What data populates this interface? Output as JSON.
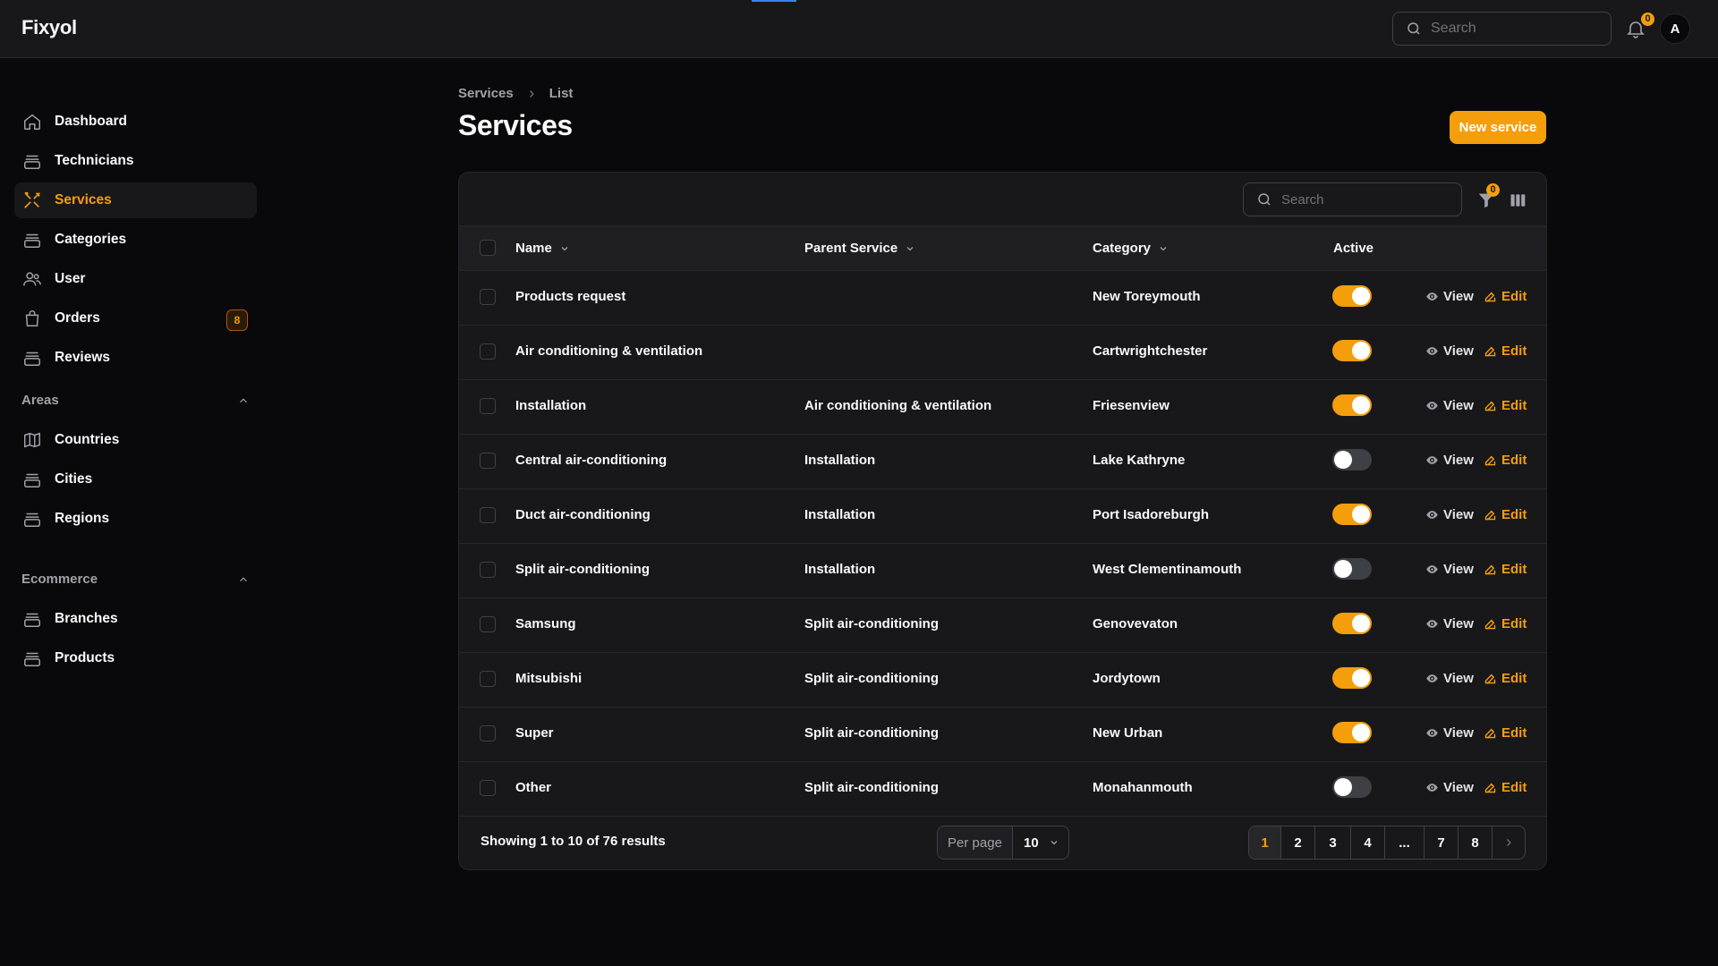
{
  "app": {
    "brand": "Fixyol"
  },
  "topbar": {
    "search_placeholder": "Search",
    "notifications_count": "0",
    "avatar_initial": "A"
  },
  "sidebar": {
    "items": [
      {
        "label": "Dashboard",
        "icon": "home-icon"
      },
      {
        "label": "Technicians",
        "icon": "archive-icon"
      },
      {
        "label": "Services",
        "icon": "tools-icon",
        "active": true
      },
      {
        "label": "Categories",
        "icon": "archive-icon"
      },
      {
        "label": "User",
        "icon": "users-icon"
      },
      {
        "label": "Orders",
        "icon": "shopping-bag-icon",
        "badge": "8"
      },
      {
        "label": "Reviews",
        "icon": "archive-icon"
      }
    ],
    "groups": [
      {
        "title": "Areas",
        "items": [
          {
            "label": "Countries",
            "icon": "map-icon"
          },
          {
            "label": "Cities",
            "icon": "archive-icon"
          },
          {
            "label": "Regions",
            "icon": "archive-icon"
          }
        ]
      },
      {
        "title": "Ecommerce",
        "items": [
          {
            "label": "Branches",
            "icon": "archive-icon"
          },
          {
            "label": "Products",
            "icon": "archive-icon"
          }
        ]
      }
    ]
  },
  "breadcrumb": {
    "items": [
      "Services",
      "List"
    ]
  },
  "page": {
    "title": "Services",
    "new_button": "New service"
  },
  "table": {
    "search_placeholder": "Search",
    "filter_count": "0",
    "columns": [
      "Name",
      "Parent Service",
      "Category",
      "Active"
    ],
    "view_label": "View",
    "edit_label": "Edit",
    "rows": [
      {
        "name": "Products request",
        "parent": "",
        "category": "New Toreymouth",
        "active": true
      },
      {
        "name": "Air conditioning & ventilation",
        "parent": "",
        "category": "Cartwrightchester",
        "active": true
      },
      {
        "name": "Installation",
        "parent": "Air conditioning & ventilation",
        "category": "Friesenview",
        "active": true
      },
      {
        "name": "Central air-conditioning",
        "parent": "Installation",
        "category": "Lake Kathryne",
        "active": false
      },
      {
        "name": "Duct air-conditioning",
        "parent": "Installation",
        "category": "Port Isadoreburgh",
        "active": true
      },
      {
        "name": "Split air-conditioning",
        "parent": "Installation",
        "category": "West Clementinamouth",
        "active": false
      },
      {
        "name": "Samsung",
        "parent": "Split air-conditioning",
        "category": "Genovevaton",
        "active": true
      },
      {
        "name": "Mitsubishi",
        "parent": "Split air-conditioning",
        "category": "Jordytown",
        "active": true
      },
      {
        "name": "Super",
        "parent": "Split air-conditioning",
        "category": "New Urban",
        "active": true
      },
      {
        "name": "Other",
        "parent": "Split air-conditioning",
        "category": "Monahanmouth",
        "active": false
      }
    ],
    "footer": {
      "summary": "Showing 1 to 10 of 76 results",
      "per_page_label": "Per page",
      "per_page_value": "10",
      "pages": [
        "1",
        "2",
        "3",
        "4",
        "...",
        "7",
        "8"
      ],
      "current_page": "1"
    }
  },
  "colors": {
    "accent": "#f59e0b",
    "background": "#09090b",
    "surface": "#18181b",
    "border": "#27272a"
  }
}
